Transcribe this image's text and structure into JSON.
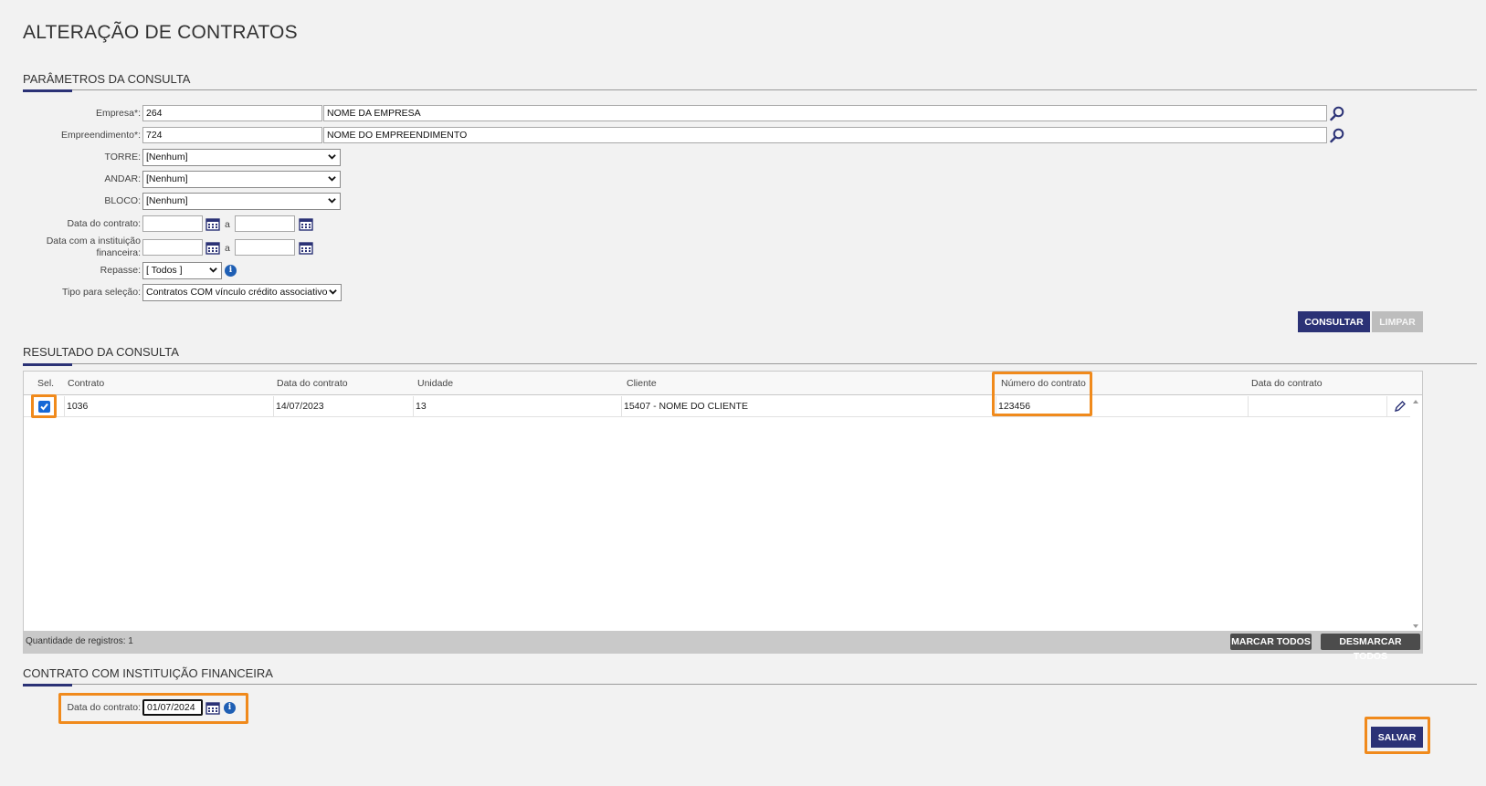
{
  "page": {
    "title": "ALTERAÇÃO DE CONTRATOS"
  },
  "params": {
    "section_title": "PARÂMETROS DA CONSULTA",
    "empresa": {
      "label": "Empresa*:",
      "code": "264",
      "name": "NOME DA EMPRESA"
    },
    "empreendimento": {
      "label": "Empreendimento*:",
      "code": "724",
      "name": "NOME DO EMPREENDIMENTO"
    },
    "torre": {
      "label": "TORRE:",
      "value": "[Nenhum]"
    },
    "andar": {
      "label": "ANDAR:",
      "value": "[Nenhum]"
    },
    "bloco": {
      "label": "BLOCO:",
      "value": "[Nenhum]"
    },
    "data_contrato": {
      "label": "Data do contrato:",
      "from": "",
      "to": "",
      "sep": "a"
    },
    "data_instituicao": {
      "label_line1": "Data com a instituição",
      "label_line2": "financeira:",
      "from": "",
      "to": "",
      "sep": "a"
    },
    "repasse": {
      "label": "Repasse:",
      "value": "[ Todos ]"
    },
    "tipo_selecao": {
      "label": "Tipo para seleção:",
      "value": "Contratos COM vínculo crédito associativo"
    },
    "consultar_label": "CONSULTAR",
    "limpar_label": "LIMPAR"
  },
  "result": {
    "section_title": "RESULTADO DA CONSULTA",
    "columns": [
      "Sel.",
      "Contrato",
      "Data do contrato",
      "Unidade",
      "Cliente",
      "Número do contrato",
      "Data do contrato"
    ],
    "rows": [
      {
        "selected": true,
        "contrato": "1036",
        "data_contrato": "14/07/2023",
        "unidade": "13",
        "cliente": "15407 - NOME DO CLIENTE",
        "numero_contrato": "123456",
        "data_contrato_inst": ""
      }
    ],
    "count_text": "Quantidade de registros: 1",
    "marcar_todos_label": "MARCAR TODOS",
    "desmarcar_todos_label": "DESMARCAR TODOS"
  },
  "instituicao": {
    "section_title": "CONTRATO COM INSTITUIÇÃO FINANCEIRA",
    "data_label": "Data do contrato:",
    "data_value": "01/07/2024",
    "salvar_label": "SALVAR"
  },
  "colors": {
    "primary": "#2b3276",
    "highlight": "#f08a1c",
    "checkbox": "#1668d6",
    "info": "#1f5fb4"
  }
}
